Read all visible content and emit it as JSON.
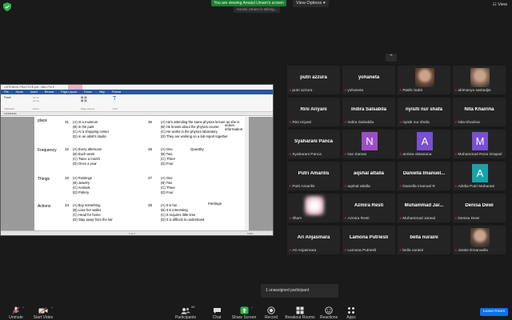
{
  "top": {
    "banner": "You are viewing Amalul Umam's screen",
    "view_options": "View Options",
    "sub_banner": "Amalul Umam is talking...",
    "view": "View"
  },
  "document": {
    "title": "LISTENING PRACTICE.pdf - Nitro Pro 8",
    "menu": [
      "File",
      "Home",
      "Insert",
      "Review",
      "Page Layout",
      "Forms",
      "Help",
      "Format"
    ],
    "ribbon_labels": [
      "Paste",
      "Clipboard",
      "Zoom",
      "Page Layout",
      "Navigation",
      "Find"
    ],
    "tab": "LISTENING",
    "status_page": "1 of 2",
    "status_zoom": "100%",
    "rows": [
      {
        "category": "place",
        "left_num": "31",
        "left_options": [
          "(A) At a museum",
          "(B) In the park",
          "(C) At a shopping center",
          "(D) In an artist's studio"
        ],
        "right_num": "35",
        "right_options": [
          "(A) He's attending the same physics lecture as she is",
          "(B) He knows about the physics course",
          "(C) He works in the physics laboratory",
          "(D) They are working on a lab report together"
        ],
        "note": "action information"
      },
      {
        "category": "Frequency",
        "left_num": "32",
        "left_options": [
          "(A) Every afternoon",
          "(B) Each week",
          "(C) Twice a month",
          "(D) Once a year"
        ],
        "right_num": "36",
        "right_options": [
          "(A) One",
          "(B) Two",
          "(C) Three",
          "(D) Four"
        ],
        "note": "Quantity"
      },
      {
        "category": "Things",
        "left_num": "33",
        "left_options": [
          "(A) Paintings",
          "(B) Jewelry",
          "(C) Animals",
          "(D) Pottery"
        ],
        "right_num": "37",
        "right_options": [
          "(A) One",
          "(B) Two",
          "(C) Three",
          "(D) Four"
        ],
        "note": ""
      },
      {
        "category": "Actions",
        "left_num": "34",
        "left_options": [
          "(A) Buy something",
          "(B) Lose her wallet",
          "(C) Head for home",
          "(D) Stay away from the fair"
        ],
        "right_num": "38",
        "right_options": [
          "(A) It is fun",
          "(B) It is interesting",
          "(C) It requires little time",
          "(D) It is difficult to understand"
        ],
        "note": "Feelings"
      }
    ]
  },
  "participants": [
    {
      "display": "putri azzura",
      "label": "putri azzura",
      "type": "name"
    },
    {
      "display": "yohaneta",
      "label": "yohaneta",
      "type": "name"
    },
    {
      "display": "",
      "label": "Rakhi Sabri",
      "type": "photo",
      "color": "#6b4a3a"
    },
    {
      "display": "",
      "label": "abimanyu satriadjie",
      "type": "photo",
      "color": "#8a6a55"
    },
    {
      "display": "Rini Ariyani",
      "label": "Rini Ariyani",
      "type": "name"
    },
    {
      "display": "Indira Salsabila",
      "label": "Indira Salsabila",
      "type": "name"
    },
    {
      "display": "nyisiti nur shafa",
      "label": "nyisiti nur shafa",
      "type": "name"
    },
    {
      "display": "Nita Khairina",
      "label": "Nita Khairina",
      "type": "name"
    },
    {
      "display": "Syaharani Panca",
      "label": "Syaharani Panca",
      "type": "name"
    },
    {
      "display": "N",
      "label": "Nur Zaman",
      "type": "avatar",
      "color": "#9b4fc0"
    },
    {
      "display": "A",
      "label": "annisa oktaviana",
      "type": "avatar",
      "color": "#7a4fd0"
    },
    {
      "display": "M",
      "label": "Muhammad Reza Grapari",
      "type": "avatar",
      "color": "#7a4fd0"
    },
    {
      "display": "Putri Amarilis",
      "label": "Putri Amarilis",
      "type": "name"
    },
    {
      "display": "aqshal attalla",
      "label": "aqshal attalla",
      "type": "name"
    },
    {
      "display": "Daniella Imanuel...",
      "label": "Daniella Imanuel R",
      "type": "name"
    },
    {
      "display": "A",
      "label": "Adelia Putri Maharani",
      "type": "avatar",
      "color": "#1aa1a8"
    },
    {
      "display": "",
      "label": "Ilham",
      "type": "blur",
      "color": "#e8b5c8"
    },
    {
      "display": "Azmira Resti",
      "label": "Azmira Resti",
      "type": "name"
    },
    {
      "display": "Muhammad Jar...",
      "label": "Muhammad Jarwal",
      "type": "name"
    },
    {
      "display": "Denisa Dewi",
      "label": "Denisa Dewi",
      "type": "name"
    },
    {
      "display": "Ari Anjasmara",
      "label": "Ari Anjasmara",
      "type": "name"
    },
    {
      "display": "Lamona Putriesli",
      "label": "Lamona Putriesli",
      "type": "name"
    },
    {
      "display": "bella nuraini",
      "label": "bella nuraini",
      "type": "name"
    },
    {
      "display": "",
      "label": "Jossie Emanuella",
      "type": "photo",
      "color": "#5a4a3a"
    }
  ],
  "unassigned": "1 unassigned participant",
  "toolbar": {
    "unmute": "Unmute",
    "start_video": "Start Video",
    "participants": "Participants",
    "participants_count": "56",
    "chat": "Chat",
    "share_screen": "Share Screen",
    "record": "Record",
    "breakout": "Breakout Rooms",
    "reactions": "Reactions",
    "apps": "Apps",
    "leave": "Leave Room"
  }
}
